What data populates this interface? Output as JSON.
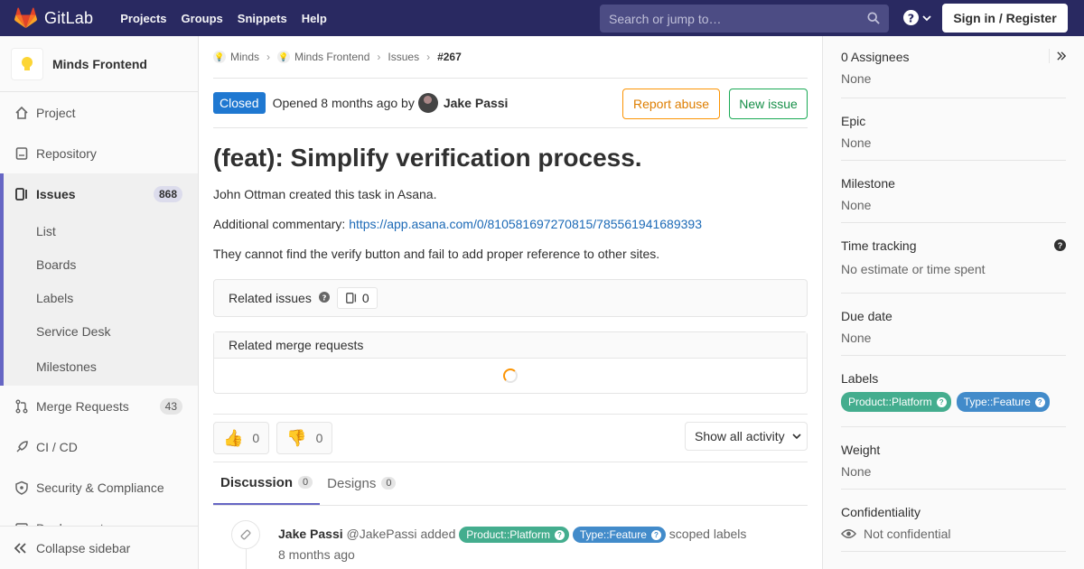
{
  "topbar": {
    "brand": "GitLab",
    "nav": [
      "Projects",
      "Groups",
      "Snippets",
      "Help"
    ],
    "search_placeholder": "Search or jump to…",
    "sign_in": "Sign in / Register"
  },
  "sidebar": {
    "project_name": "Minds Frontend",
    "items": [
      {
        "label": "Project",
        "icon": "home-icon"
      },
      {
        "label": "Repository",
        "icon": "doc-icon"
      },
      {
        "label": "Issues",
        "icon": "issues-icon",
        "count": "868"
      },
      {
        "label": "Merge Requests",
        "icon": "merge-icon",
        "count": "43"
      },
      {
        "label": "CI / CD",
        "icon": "rocket-icon"
      },
      {
        "label": "Security & Compliance",
        "icon": "shield-icon"
      },
      {
        "label": "Deployments",
        "icon": "deploy-icon"
      }
    ],
    "issue_sub": [
      "List",
      "Boards",
      "Labels",
      "Service Desk",
      "Milestones"
    ],
    "collapse": "Collapse sidebar"
  },
  "breadcrumb": [
    "Minds",
    "Minds Frontend",
    "Issues",
    "#267"
  ],
  "issue": {
    "status": "Closed",
    "opened_text": "Opened 8 months ago by",
    "author": "Jake Passi",
    "report_abuse": "Report abuse",
    "new_issue": "New issue",
    "title": "(feat): Simplify verification process.",
    "desc_line1": "John Ottman created this task in Asana.",
    "desc_line2_prefix": "Additional commentary:",
    "desc_link": "https://app.asana.com/0/810581697270815/785561941689393",
    "desc_line3": "They cannot find the verify button and fail to add proper reference to other sites."
  },
  "related_issues": {
    "label": "Related issues",
    "count": "0"
  },
  "related_mrs": {
    "label": "Related merge requests"
  },
  "awards": {
    "thumbs_up": "0",
    "thumbs_down": "0",
    "activity_filter": "Show all activity"
  },
  "tabs": [
    {
      "label": "Discussion",
      "count": "0"
    },
    {
      "label": "Designs",
      "count": "0"
    }
  ],
  "note": {
    "author": "Jake Passi",
    "username": "@JakePassi",
    "action": "added",
    "suffix": "scoped labels",
    "time": "8 months ago"
  },
  "labels": [
    {
      "text": "Product::Platform",
      "color": "#44ad8e"
    },
    {
      "text": "Type::Feature",
      "color": "#428bca"
    }
  ],
  "right": {
    "assignees_h": "0 Assignees",
    "assignees_v": "None",
    "epic_h": "Epic",
    "epic_v": "None",
    "milestone_h": "Milestone",
    "milestone_v": "None",
    "time_h": "Time tracking",
    "time_v": "No estimate or time spent",
    "due_h": "Due date",
    "due_v": "None",
    "labels_h": "Labels",
    "weight_h": "Weight",
    "weight_v": "None",
    "conf_h": "Confidentiality",
    "conf_v": "Not confidential"
  },
  "colors": {
    "navbar": "#292961",
    "accent": "#6666c4",
    "closed": "#1f78d1",
    "link": "#1b69b6"
  }
}
